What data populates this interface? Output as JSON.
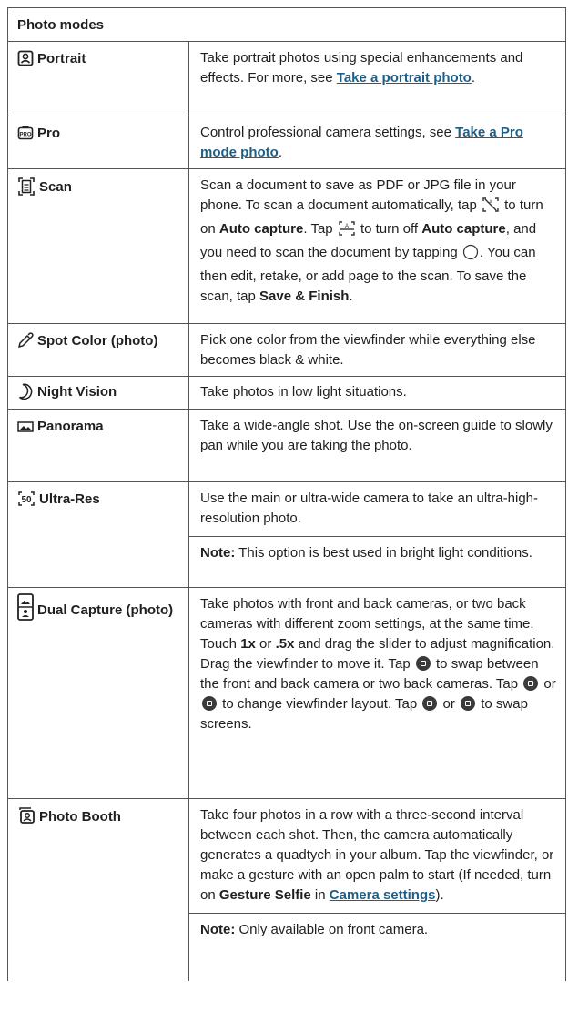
{
  "table": {
    "header": "Photo modes",
    "rows": [
      {
        "name": "Portrait",
        "icon": "portrait-icon",
        "text1": "Take portrait photos using special enhancements and effects. For more, see ",
        "link": "Take a portrait photo",
        "text2": "."
      },
      {
        "name": "Pro",
        "icon": "pro-icon",
        "text1": "Control professional camera settings, see ",
        "link": "Take a Pro mode photo",
        "text2": "."
      },
      {
        "name": "Scan",
        "icon": "scan-icon",
        "t1": "Scan a document to save as PDF or JPG file in your phone. To scan a document automatically, tap ",
        "t2": " to turn on ",
        "b1": "Auto capture",
        "t3": ". Tap ",
        "t4": " to turn off ",
        "b2": "Auto capture",
        "t5": ", and you need to scan the document by tapping ",
        "t6": ". You can then edit, retake, or add page to the scan. To save the scan, tap ",
        "b3": "Save & Finish",
        "t7": "."
      },
      {
        "name": "Spot Color (photo)",
        "icon": "eyedropper-icon",
        "text": "Pick one color from the viewfinder while everything else becomes black & white."
      },
      {
        "name": "Night Vision",
        "icon": "moon-icon",
        "text": "Take photos in low light situations."
      },
      {
        "name": "Panorama",
        "icon": "panorama-icon",
        "text": "Take a wide-angle shot. Use the on-screen guide to slowly pan while you are taking the photo."
      },
      {
        "name": "Ultra-Res",
        "icon": "ultra-res-icon",
        "icon_label": "50",
        "text": "Use the main or ultra-wide camera to take an ultra-high-resolution photo.",
        "note_label": "Note:",
        "note": " This option is best used in bright light conditions."
      },
      {
        "name": "Dual Capture (photo)",
        "icon": "dual-capture-icon",
        "t1": "Take photos with front and back cameras, or two back cameras with different zoom settings, at the same time. Touch ",
        "b1": "1x",
        "t2": " or ",
        "b2": ".5x",
        "t3": " and drag the slider to adjust magnification. Drag the viewfinder to move it. Tap ",
        "t4": " to swap between the front and back camera or two back cameras. Tap ",
        "t5": " or ",
        "t6": " to change viewfinder layout. Tap ",
        "t7": " or ",
        "t8": " to swap screens."
      },
      {
        "name": "Photo Booth",
        "icon": "photo-booth-icon",
        "t1": "Take four photos in a row with a three-second interval between each shot. Then, the camera automatically generates a quadtych in your album. Tap the viewfinder, or make a gesture with an open palm to start (If needed, turn on ",
        "b1": "Gesture Selfie",
        "t2": " in ",
        "link": "Camera settings",
        "t3": ").",
        "note_label": "Note:",
        "note": " Only available on front camera."
      }
    ]
  }
}
